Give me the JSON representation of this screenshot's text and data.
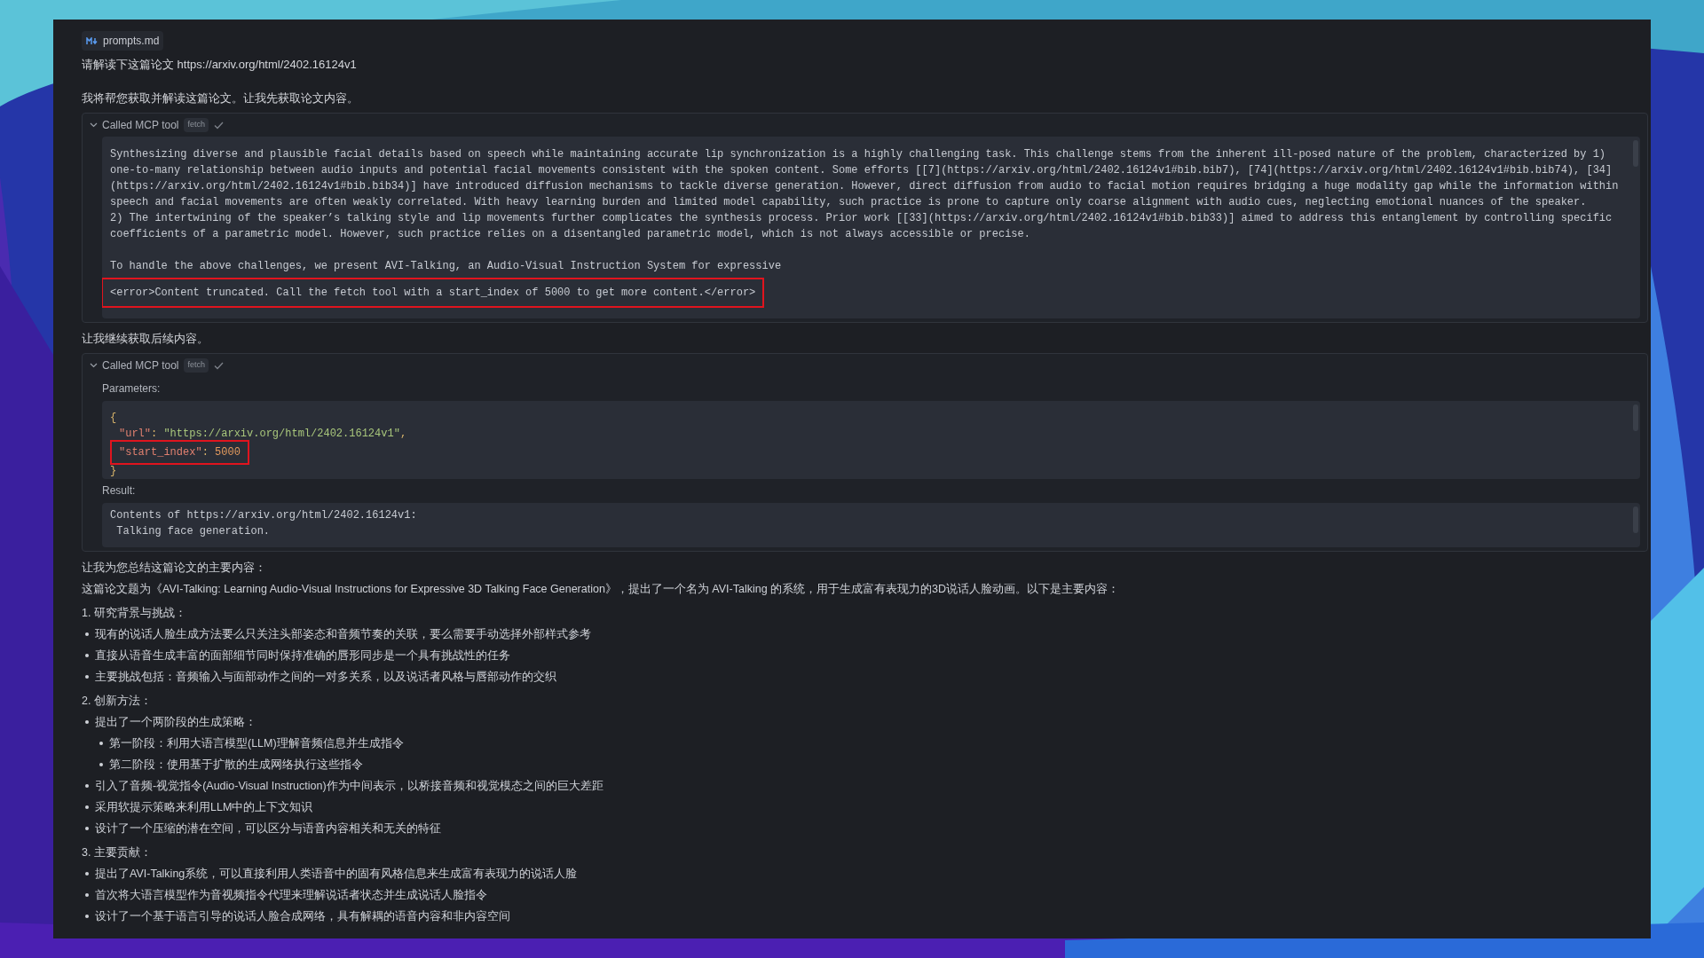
{
  "attachment": {
    "label": "prompts.md"
  },
  "messages": [
    {
      "kind": "user",
      "text": "请解读下这篇论文 https://arxiv.org/html/2402.16124v1"
    },
    {
      "kind": "assistant",
      "text": "我将帮您获取并解读这篇论文。让我先获取论文内容。"
    },
    {
      "kind": "tool",
      "title": "Called MCP tool",
      "tag": "fetch",
      "expanded": true,
      "done": true,
      "sections": [
        {
          "kind": "output",
          "lines": [
            {
              "text": "Synthesizing diverse and plausible facial details based on speech while maintaining accurate lip synchronization is a highly challenging task. This challenge stems from the inherent ill-posed nature of the problem, characterized by 1)",
              "highlighted": false
            },
            {
              "text": "one-to-many relationship between audio inputs and potential facial movements consistent with the spoken content. Some efforts [[7](https://arxiv.org/html/2402.16124v1#bib.bib7), [74](https://arxiv.org/html/2402.16124v1#bib.bib74), [34]",
              "highlighted": false
            },
            {
              "text": "(https://arxiv.org/html/2402.16124v1#bib.bib34)] have introduced diffusion mechanisms to tackle diverse generation. However, direct diffusion from audio to facial motion requires bridging a huge modality gap while the information within",
              "highlighted": false
            },
            {
              "text": "speech and facial movements are often weakly correlated. With heavy learning burden and limited model capability, such practice is prone to capture only coarse alignment with audio cues, neglecting emotional nuances of the speaker.",
              "highlighted": false
            },
            {
              "text": "2) The intertwining of the speaker’s talking style and lip movements further complicates the synthesis process. Prior work [[33](https://arxiv.org/html/2402.16124v1#bib.bib33)] aimed to address this entanglement by controlling specific",
              "highlighted": false
            },
            {
              "text": "coefficients of a parametric model. However, such practice relies on a disentangled parametric model, which is not always accessible or precise.",
              "highlighted": false
            },
            {
              "text": "To handle the above challenges, we present AVI-Talking, an Audio-Visual Instruction System for expressive",
              "highlighted": false,
              "spaced": true
            },
            {
              "text": "<error>Content truncated. Call the fetch tool with a start_index of 5000 to get more content.</error>",
              "highlighted": true
            }
          ]
        }
      ]
    },
    {
      "kind": "assistant",
      "text": "让我继续获取后续内容。"
    },
    {
      "kind": "tool",
      "title": "Called MCP tool",
      "tag": "fetch",
      "expanded": true,
      "done": true,
      "sections": [
        {
          "kind": "params",
          "label": "Parameters:",
          "lines": [
            {
              "highlighted": false,
              "tokens": [
                {
                  "kind": "punct",
                  "text": "{"
                }
              ]
            },
            {
              "highlighted": false,
              "tokens": [
                {
                  "kind": "key",
                  "text": "\"url\""
                },
                {
                  "kind": "punct",
                  "text": ": "
                },
                {
                  "kind": "string",
                  "text": "\"https://arxiv.org/html/2402.16124v1\""
                },
                {
                  "kind": "punct",
                  "text": ","
                }
              ]
            },
            {
              "highlighted": true,
              "tokens": [
                {
                  "kind": "key",
                  "text": "\"start_index\""
                },
                {
                  "kind": "punct",
                  "text": ": "
                },
                {
                  "kind": "number",
                  "text": "5000"
                }
              ]
            },
            {
              "highlighted": false,
              "tokens": [
                {
                  "kind": "punct",
                  "text": "}"
                }
              ]
            }
          ]
        },
        {
          "kind": "output",
          "label": "Result:",
          "lines": [
            {
              "text": "Contents of https://arxiv.org/html/2402.16124v1:",
              "highlighted": false
            },
            {
              "text": " Talking face generation.",
              "highlighted": false
            }
          ]
        }
      ]
    },
    {
      "kind": "summary",
      "blocks": [
        {
          "kind": "para",
          "text": "让我为您总结这篇论文的主要内容："
        },
        {
          "kind": "para",
          "text": "这篇论文题为《AVI-Talking: Learning Audio-Visual Instructions for Expressive 3D Talking Face Generation》，提出了一个名为 AVI-Talking 的系统，用于生成富有表现力的3D说话人脸动画。以下是主要内容："
        },
        {
          "kind": "heading",
          "text": "1. 研究背景与挑战："
        },
        {
          "kind": "bullet",
          "text": "现有的说话人脸生成方法要么只关注头部姿态和音频节奏的关联，要么需要手动选择外部样式参考"
        },
        {
          "kind": "bullet",
          "text": "直接从语音生成丰富的面部细节同时保持准确的唇形同步是一个具有挑战性的任务"
        },
        {
          "kind": "bullet",
          "text": "主要挑战包括：音频输入与面部动作之间的一对多关系，以及说话者风格与唇部动作的交织"
        },
        {
          "kind": "heading",
          "text": "2. 创新方法："
        },
        {
          "kind": "bullet",
          "text": "提出了一个两阶段的生成策略：",
          "children": [
            {
              "text": "第一阶段：利用大语言模型(LLM)理解音频信息并生成指令"
            },
            {
              "text": "第二阶段：使用基于扩散的生成网络执行这些指令"
            }
          ]
        },
        {
          "kind": "bullet",
          "text": "引入了音频-视觉指令(Audio-Visual Instruction)作为中间表示，以桥接音频和视觉模态之间的巨大差距"
        },
        {
          "kind": "bullet",
          "text": "采用软提示策略来利用LLM中的上下文知识"
        },
        {
          "kind": "bullet",
          "text": "设计了一个压缩的潜在空间，可以区分与语音内容相关和无关的特征"
        },
        {
          "kind": "heading",
          "text": "3. 主要贡献："
        },
        {
          "kind": "bullet",
          "text": "提出了AVI-Talking系统，可以直接利用人类语音中的固有风格信息来生成富有表现力的说话人脸"
        },
        {
          "kind": "bullet",
          "text": "首次将大语言模型作为音视频指令代理来理解说话者状态并生成说话人脸指令"
        },
        {
          "kind": "bullet",
          "text": "设计了一个基于语言引导的说话人脸合成网络，具有解耦的语音内容和非内容空间"
        }
      ]
    }
  ]
}
